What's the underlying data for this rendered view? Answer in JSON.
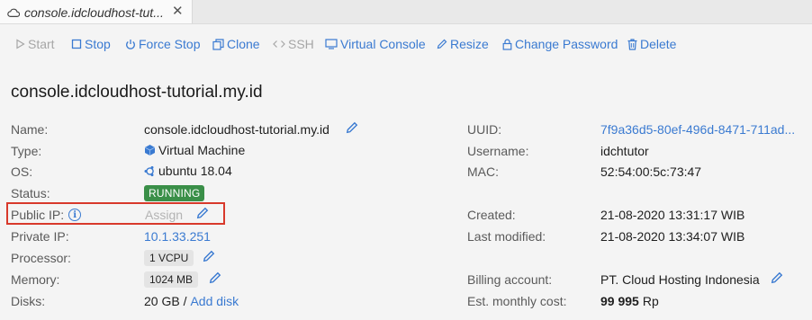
{
  "tab": {
    "title": "console.idcloudhost-tut...",
    "close": "✕"
  },
  "toolbar": {
    "start": "Start",
    "stop": "Stop",
    "force_stop": "Force Stop",
    "clone": "Clone",
    "ssh": "SSH",
    "virtual_console": "Virtual Console",
    "resize": "Resize",
    "change_password": "Change Password",
    "delete": "Delete"
  },
  "vm": {
    "title": "console.idcloudhost-tutorial.my.id",
    "left": {
      "name_label": "Name:",
      "name": "console.idcloudhost-tutorial.my.id",
      "type_label": "Type:",
      "type": "Virtual Machine",
      "os_label": "OS:",
      "os": "ubuntu 18.04",
      "status_label": "Status:",
      "status": "RUNNING",
      "public_ip_label": "Public IP:",
      "public_ip_info": "i",
      "public_ip_assign": "Assign",
      "private_ip_label": "Private IP:",
      "private_ip": "10.1.33.251",
      "processor_label": "Processor:",
      "processor": "1 VCPU",
      "memory_label": "Memory:",
      "memory": "1024 MB",
      "disks_label": "Disks:",
      "disks": "20 GB /",
      "add_disk": "Add disk"
    },
    "right": {
      "uuid_label": "UUID:",
      "uuid": "7f9a36d5-80ef-496d-8471-711ad...",
      "username_label": "Username:",
      "username": "idchtutor",
      "mac_label": "MAC:",
      "mac": "52:54:00:5c:73:47",
      "created_label": "Created:",
      "created": "21-08-2020 13:31:17 WIB",
      "modified_label": "Last modified:",
      "modified": "21-08-2020 13:34:07 WIB",
      "billing_label": "Billing account:",
      "billing": "PT. Cloud Hosting Indonesia",
      "cost_label": "Est. monthly cost:",
      "cost_amount": "99 995",
      "cost_currency": "Rp"
    }
  },
  "colors": {
    "link": "#3a7ad1",
    "running": "#3a8f48",
    "highlight": "#d8392b"
  },
  "icons": [
    "cloud-icon",
    "close-icon",
    "play-icon",
    "stop-icon",
    "power-icon",
    "clone-icon",
    "code-icon",
    "monitor-icon",
    "pencil-icon",
    "lock-icon",
    "trash-icon",
    "cube-icon",
    "ubuntu-icon",
    "info-icon"
  ]
}
